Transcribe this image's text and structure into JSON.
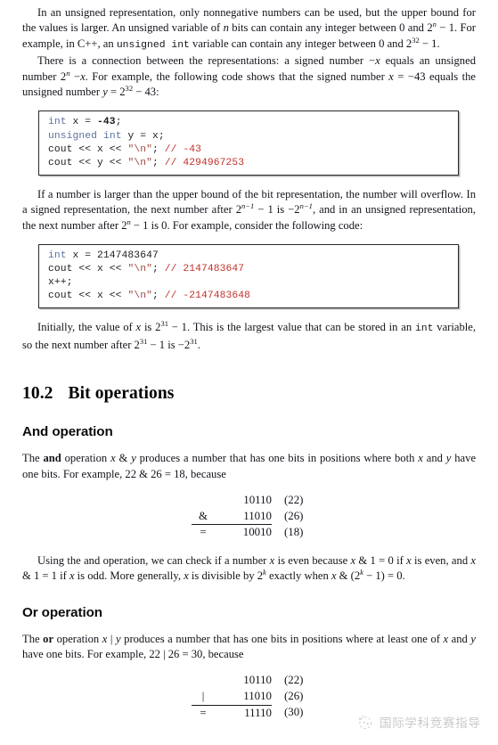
{
  "document": {
    "paragraphs": {
      "p1": {
        "segments": [
          {
            "t": "In an unsigned representation, only nonnegative numbers can be used, but the upper bound for the values is larger.  An unsigned variable of ",
            "s": "plain"
          },
          {
            "t": "n",
            "s": "italic"
          },
          {
            "t": " bits can contain any integer between 0 and 2",
            "s": "plain"
          },
          {
            "t": "n",
            "s": "sup-italic"
          },
          {
            "t": " − 1. For example, in C++, an ",
            "s": "plain"
          },
          {
            "t": "unsigned int",
            "s": "mono"
          },
          {
            "t": " variable can contain any integer between 0 and 2",
            "s": "plain"
          },
          {
            "t": "32",
            "s": "sup"
          },
          {
            "t": " − 1.",
            "s": "plain"
          }
        ]
      },
      "p2": {
        "segments": [
          {
            "t": "There is a connection between the representations:  a signed number −",
            "s": "plain"
          },
          {
            "t": "x",
            "s": "italic"
          },
          {
            "t": " equals an unsigned number 2",
            "s": "plain"
          },
          {
            "t": "n",
            "s": "sup-italic"
          },
          {
            "t": " −",
            "s": "plain"
          },
          {
            "t": "x",
            "s": "italic"
          },
          {
            "t": ". For example, the following code shows that the signed number ",
            "s": "plain"
          },
          {
            "t": "x",
            "s": "italic"
          },
          {
            "t": " = −43 equals the unsigned number ",
            "s": "plain"
          },
          {
            "t": "y",
            "s": "italic"
          },
          {
            "t": " = 2",
            "s": "plain"
          },
          {
            "t": "32",
            "s": "sup"
          },
          {
            "t": " − 43:",
            "s": "plain"
          }
        ]
      },
      "p3": {
        "segments": [
          {
            "t": "If a number is larger than the upper bound of the bit representation, the number will overflow. In a signed representation, the next number after 2",
            "s": "plain"
          },
          {
            "t": "n−1",
            "s": "sup-italic"
          },
          {
            "t": " − 1 is −2",
            "s": "plain"
          },
          {
            "t": "n−1",
            "s": "sup-italic"
          },
          {
            "t": ", and in an unsigned representation, the next number after 2",
            "s": "plain"
          },
          {
            "t": "n",
            "s": "sup-italic"
          },
          {
            "t": " − 1 is 0. For example, consider the following code:",
            "s": "plain"
          }
        ]
      },
      "p4": {
        "segments": [
          {
            "t": "Initially, the value of ",
            "s": "plain"
          },
          {
            "t": "x",
            "s": "italic"
          },
          {
            "t": " is 2",
            "s": "plain"
          },
          {
            "t": "31",
            "s": "sup"
          },
          {
            "t": " − 1. This is the largest value that can be stored in an ",
            "s": "plain"
          },
          {
            "t": "int",
            "s": "mono"
          },
          {
            "t": " variable, so the next number after 2",
            "s": "plain"
          },
          {
            "t": "31",
            "s": "sup"
          },
          {
            "t": " − 1 is −2",
            "s": "plain"
          },
          {
            "t": "31",
            "s": "sup"
          },
          {
            "t": ".",
            "s": "plain"
          }
        ]
      },
      "p5": {
        "segments": [
          {
            "t": "The ",
            "s": "plain"
          },
          {
            "t": "and",
            "s": "bold"
          },
          {
            "t": " operation ",
            "s": "plain"
          },
          {
            "t": "x",
            "s": "italic"
          },
          {
            "t": " & ",
            "s": "plain"
          },
          {
            "t": "y",
            "s": "italic"
          },
          {
            "t": " produces a number that has one bits in positions where both ",
            "s": "plain"
          },
          {
            "t": "x",
            "s": "italic"
          },
          {
            "t": " and ",
            "s": "plain"
          },
          {
            "t": "y",
            "s": "italic"
          },
          {
            "t": " have one bits. For example, 22 & 26 = 18, because",
            "s": "plain"
          }
        ]
      },
      "p6": {
        "segments": [
          {
            "t": "Using the and operation, we can check if a number ",
            "s": "plain"
          },
          {
            "t": "x",
            "s": "italic"
          },
          {
            "t": " is even because ",
            "s": "plain"
          },
          {
            "t": "x",
            "s": "italic"
          },
          {
            "t": " & 1 = 0 if ",
            "s": "plain"
          },
          {
            "t": "x",
            "s": "italic"
          },
          {
            "t": " is even, and ",
            "s": "plain"
          },
          {
            "t": "x",
            "s": "italic"
          },
          {
            "t": " & 1 = 1 if ",
            "s": "plain"
          },
          {
            "t": "x",
            "s": "italic"
          },
          {
            "t": " is odd. More generally, ",
            "s": "plain"
          },
          {
            "t": "x",
            "s": "italic"
          },
          {
            "t": " is divisible by 2",
            "s": "plain"
          },
          {
            "t": "k",
            "s": "sup-italic"
          },
          {
            "t": " exactly when ",
            "s": "plain"
          },
          {
            "t": "x",
            "s": "italic"
          },
          {
            "t": " & (2",
            "s": "plain"
          },
          {
            "t": "k",
            "s": "sup-italic"
          },
          {
            "t": " − 1) = 0.",
            "s": "plain"
          }
        ]
      },
      "p7": {
        "segments": [
          {
            "t": "The ",
            "s": "plain"
          },
          {
            "t": "or",
            "s": "bold"
          },
          {
            "t": " operation ",
            "s": "plain"
          },
          {
            "t": "x",
            "s": "italic"
          },
          {
            "t": " | ",
            "s": "plain"
          },
          {
            "t": "y",
            "s": "italic"
          },
          {
            "t": " produces a number that has one bits in positions where at least one of ",
            "s": "plain"
          },
          {
            "t": "x",
            "s": "italic"
          },
          {
            "t": " and ",
            "s": "plain"
          },
          {
            "t": "y",
            "s": "italic"
          },
          {
            "t": " have one bits. For example, 22 | 26 = 30, because",
            "s": "plain"
          }
        ]
      }
    },
    "code_block_1": {
      "lines": [
        [
          {
            "t": "int",
            "c": "kw"
          },
          {
            "t": " x = ",
            "c": "plain"
          },
          {
            "t": "-43",
            "c": "plain-bold"
          },
          {
            "t": ";",
            "c": "plain"
          }
        ],
        [
          {
            "t": "unsigned",
            "c": "kw"
          },
          {
            "t": " ",
            "c": "plain"
          },
          {
            "t": "int",
            "c": "kw"
          },
          {
            "t": " y = x;",
            "c": "plain"
          }
        ],
        [
          {
            "t": "cout << x << ",
            "c": "plain"
          },
          {
            "t": "\"\\n\"",
            "c": "str"
          },
          {
            "t": "; ",
            "c": "plain"
          },
          {
            "t": "// -43",
            "c": "cmt"
          }
        ],
        [
          {
            "t": "cout << y << ",
            "c": "plain"
          },
          {
            "t": "\"\\n\"",
            "c": "str"
          },
          {
            "t": "; ",
            "c": "plain"
          },
          {
            "t": "// 4294967253",
            "c": "cmt"
          }
        ]
      ]
    },
    "code_block_2": {
      "lines": [
        [
          {
            "t": "int",
            "c": "kw"
          },
          {
            "t": " x = 2147483647",
            "c": "plain"
          }
        ],
        [
          {
            "t": "cout << x << ",
            "c": "plain"
          },
          {
            "t": "\"\\n\"",
            "c": "str"
          },
          {
            "t": "; ",
            "c": "plain"
          },
          {
            "t": "// 2147483647",
            "c": "cmt"
          }
        ],
        [
          {
            "t": "x++;",
            "c": "plain"
          }
        ],
        [
          {
            "t": "cout << x << ",
            "c": "plain"
          },
          {
            "t": "\"\\n\"",
            "c": "str"
          },
          {
            "t": "; ",
            "c": "plain"
          },
          {
            "t": "// -2147483648",
            "c": "cmt"
          }
        ]
      ]
    },
    "section": {
      "number": "10.2",
      "title": "Bit operations"
    },
    "subsection_and": "And operation",
    "subsection_or": "Or operation",
    "bitmath_and": {
      "rows": [
        {
          "op": "",
          "bits": "10110",
          "dec": "(22)",
          "ruled": false
        },
        {
          "op": "&",
          "bits": "11010",
          "dec": "(26)",
          "ruled": false
        },
        {
          "op": "=",
          "bits": "10010",
          "dec": "(18)",
          "ruled": true
        }
      ]
    },
    "bitmath_or": {
      "rows": [
        {
          "op": "",
          "bits": "10110",
          "dec": "(22)",
          "ruled": false
        },
        {
          "op": "|",
          "bits": "11010",
          "dec": "(26)",
          "ruled": false
        },
        {
          "op": "=",
          "bits": "11110",
          "dec": "(30)",
          "ruled": true
        }
      ]
    },
    "watermark": {
      "text": "国际学科竞赛指导",
      "logo_icon": "circle-sparkle-icon",
      "color": "#7a7a7a"
    },
    "colors": {
      "keyword": "#5a6fa0",
      "string": "#9c4a45",
      "comment": "#c2302a",
      "text": "#12131a",
      "code_border": "#2a2a2a"
    }
  }
}
